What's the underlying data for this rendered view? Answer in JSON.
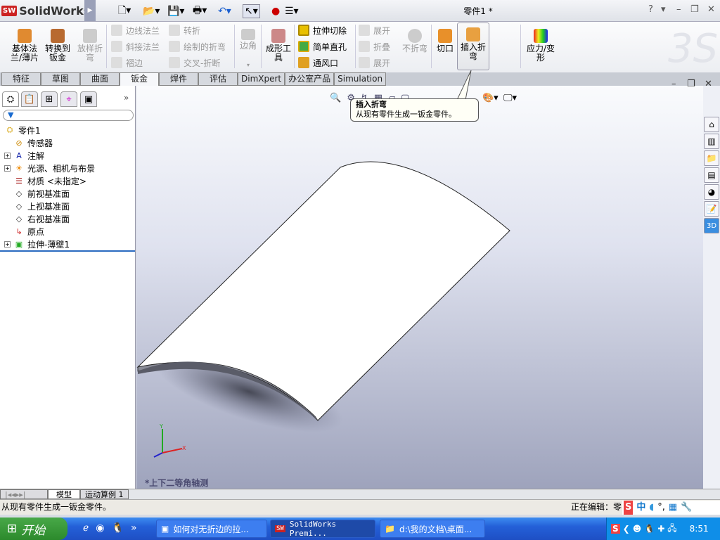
{
  "app": {
    "name": "SolidWorks",
    "document_title": "零件1 *",
    "help": "?"
  },
  "quick_access": [
    "new-icon",
    "open-icon",
    "save-icon",
    "print-icon",
    "undo-icon",
    "select-icon",
    "rebuild-icon",
    "options-icon"
  ],
  "ribbon": {
    "big": [
      {
        "label": "基体法\n兰/薄片",
        "enabled": true
      },
      {
        "label": "转换到\n钣金",
        "enabled": true
      },
      {
        "label": "放样折\n弯",
        "enabled": false
      }
    ],
    "col1": [
      {
        "label": "边线法兰",
        "enabled": false
      },
      {
        "label": "斜接法兰",
        "enabled": false
      },
      {
        "label": "褶边",
        "enabled": false
      }
    ],
    "col2": [
      {
        "label": "转折",
        "enabled": false
      },
      {
        "label": "绘制的折弯",
        "enabled": false
      },
      {
        "label": "交叉-折断",
        "enabled": false
      }
    ],
    "corner": {
      "label": "边角",
      "enabled": false
    },
    "forming": {
      "label": "成形工\n具"
    },
    "col3": [
      {
        "label": "拉伸切除",
        "enabled": true
      },
      {
        "label": "简单直孔",
        "enabled": true
      },
      {
        "label": "通风口",
        "enabled": true
      }
    ],
    "col4": [
      {
        "label": "展开",
        "enabled": false
      },
      {
        "label": "折叠",
        "enabled": false
      },
      {
        "label": "展开",
        "enabled": false
      }
    ],
    "no_bends": {
      "label": "不折弯",
      "enabled": false
    },
    "rip": {
      "label": "切口"
    },
    "insert_bends": {
      "label": "插入折\n弯"
    },
    "stress": {
      "label": "应力/变\n形"
    }
  },
  "tabs": [
    {
      "label": "特征"
    },
    {
      "label": "草图"
    },
    {
      "label": "曲面"
    },
    {
      "label": "钣金",
      "active": true
    },
    {
      "label": "焊件"
    },
    {
      "label": "评估"
    },
    {
      "label": "DimXpert"
    },
    {
      "label": "办公室产品"
    },
    {
      "label": "Simulation"
    }
  ],
  "tree": [
    {
      "label": "零件1",
      "expand": false,
      "level": 0,
      "icon": "part-icon"
    },
    {
      "label": "传感器",
      "expand": false,
      "level": 1,
      "icon": "sensor-icon"
    },
    {
      "label": "注解",
      "expand": true,
      "level": 1,
      "icon": "annotation-icon"
    },
    {
      "label": "光源、相机与布景",
      "expand": true,
      "level": 1,
      "icon": "lights-icon"
    },
    {
      "label": "材质 <未指定>",
      "expand": false,
      "level": 1,
      "icon": "material-icon"
    },
    {
      "label": "前视基准面",
      "expand": false,
      "level": 1,
      "icon": "plane-icon"
    },
    {
      "label": "上视基准面",
      "expand": false,
      "level": 1,
      "icon": "plane-icon"
    },
    {
      "label": "右视基准面",
      "expand": false,
      "level": 1,
      "icon": "plane-icon"
    },
    {
      "label": "原点",
      "expand": false,
      "level": 1,
      "icon": "origin-icon"
    },
    {
      "label": "拉伸-薄壁1",
      "expand": true,
      "level": 1,
      "icon": "extrude-icon"
    }
  ],
  "tooltip": {
    "title": "插入折弯",
    "body": "从现有零件生成一钣金零件。"
  },
  "viewport": {
    "view_name": "*上下二等角轴测"
  },
  "bottom_tabs": [
    {
      "label": "模型",
      "active": true
    },
    {
      "label": "运动算例 1"
    }
  ],
  "status": {
    "message": "从现有零件生成一钣金零件。",
    "editing": "正在编辑：零"
  },
  "taskbar": {
    "start": "开始",
    "tasks": [
      {
        "label": "如何对无折边的拉...",
        "active": false
      },
      {
        "label": "SolidWorks Premi...",
        "active": true
      },
      {
        "label": "d:\\我的文档\\桌面...",
        "active": false
      }
    ],
    "clock": "8:51"
  },
  "ime": {
    "label": "中"
  }
}
